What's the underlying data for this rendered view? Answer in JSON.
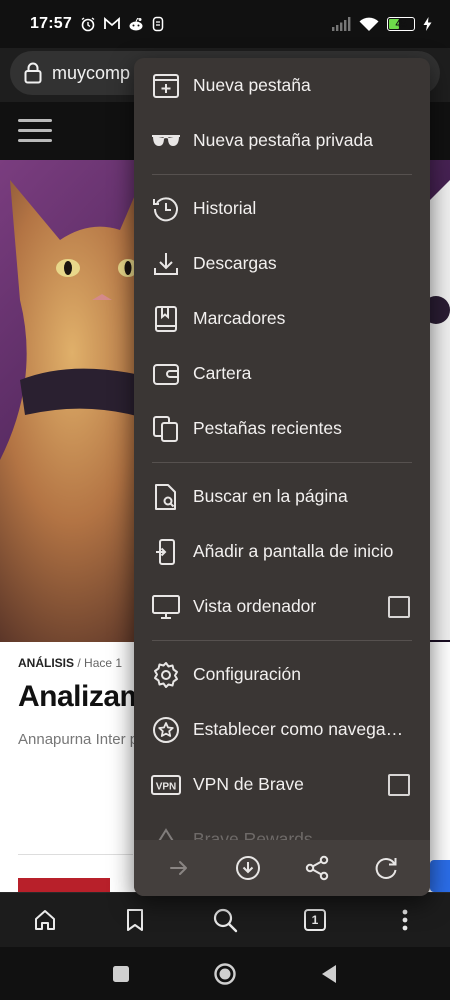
{
  "status_bar": {
    "time": "17:57",
    "battery_level": "45",
    "battery_fraction": 0.45,
    "left_icons": [
      "alarm-icon",
      "gmail-icon",
      "reddit-icon",
      "notification-icon"
    ],
    "right_icons": [
      "signal-icon",
      "wifi-icon",
      "battery-icon",
      "charging-icon"
    ]
  },
  "url_bar": {
    "url": "muycomp"
  },
  "article": {
    "category": "ANÁLISIS",
    "meta_sep": "/",
    "time": "Hace 1",
    "title": "Analizamo de un gat",
    "excerpt": "Annapurna Inter pequeño estudio aventura felina l"
  },
  "menu": {
    "items": [
      {
        "label": "Nueva pestaña",
        "icon": "new-tab-icon"
      },
      {
        "label": "Nueva pestaña privada",
        "icon": "private-tab-icon"
      },
      {
        "label": "Historial",
        "icon": "history-icon"
      },
      {
        "label": "Descargas",
        "icon": "download-icon"
      },
      {
        "label": "Marcadores",
        "icon": "bookmarks-icon"
      },
      {
        "label": "Cartera",
        "icon": "wallet-icon"
      },
      {
        "label": "Pestañas recientes",
        "icon": "recent-tabs-icon"
      },
      {
        "label": "Buscar en la página",
        "icon": "find-in-page-icon"
      },
      {
        "label": "Añadir a pantalla de inicio",
        "icon": "add-to-home-icon"
      },
      {
        "label": "Vista ordenador",
        "icon": "desktop-view-icon",
        "checked": false
      },
      {
        "label": "Configuración",
        "icon": "settings-icon"
      },
      {
        "label": "Establecer como navegador predeterminado",
        "icon": "default-browser-icon"
      },
      {
        "label": "VPN de Brave",
        "icon": "vpn-icon",
        "checked": false
      },
      {
        "label": "Brave Rewards",
        "icon": "rewards-icon"
      }
    ],
    "actions": [
      "forward-icon",
      "download-page-icon",
      "share-icon",
      "reload-icon"
    ]
  },
  "toolbar": {
    "tab_count": "1",
    "buttons": [
      "home-icon",
      "bookmark-icon",
      "search-icon",
      "tabs-icon",
      "more-options-icon"
    ]
  },
  "navbar": {
    "buttons": [
      "recents-icon",
      "home-nav-icon",
      "back-icon"
    ]
  },
  "colors": {
    "menu_bg": "#3a3634",
    "menu_actions_bg": "#443f3d",
    "battery_green": "#6fdc4b",
    "article_accent": "#b8202a"
  }
}
